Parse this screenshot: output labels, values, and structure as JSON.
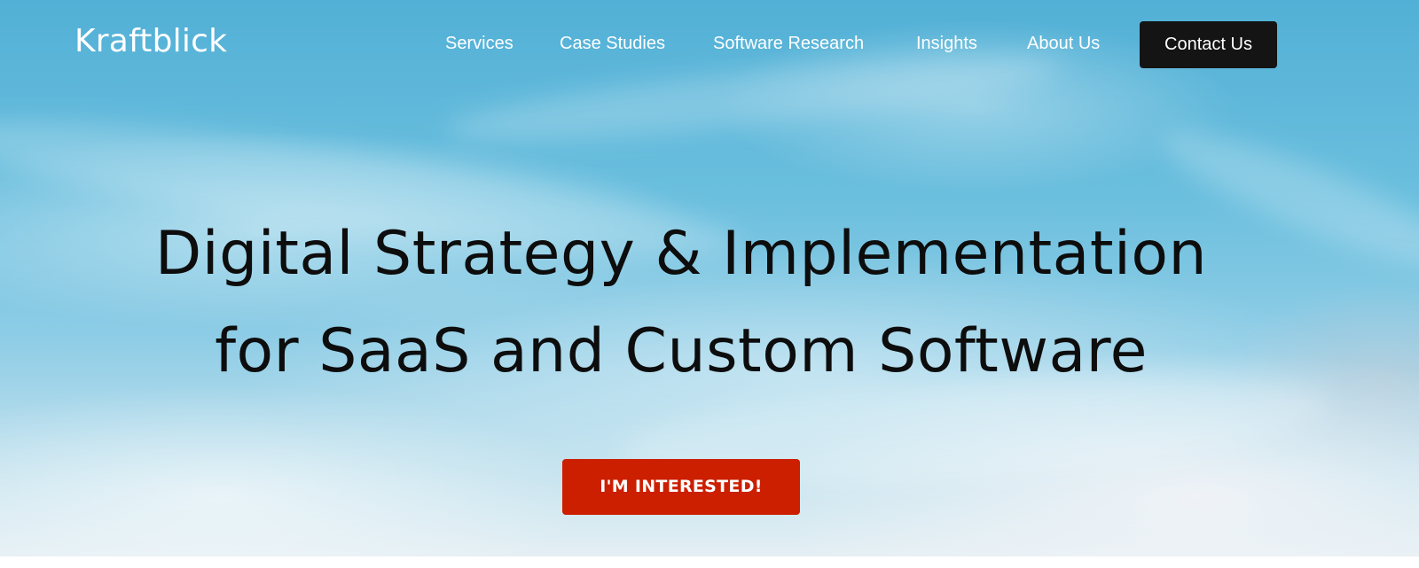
{
  "brand": {
    "name": "Kraftblick"
  },
  "nav": {
    "links": [
      {
        "label": "Services"
      },
      {
        "label": "Case Studies"
      },
      {
        "label": "Software Research"
      },
      {
        "label": "Insights"
      },
      {
        "label": "About Us"
      }
    ],
    "contact_label": "Contact Us"
  },
  "hero": {
    "headline_line1": "Digital Strategy & Implementation",
    "headline_line2": "for SaaS and Custom Software",
    "cta_label": "I'M INTERESTED!"
  },
  "colors": {
    "sky": "#6bbfde",
    "contact_button": "#141414",
    "cta_button": "#cc1f00",
    "headline_text": "#0d0d0d"
  }
}
